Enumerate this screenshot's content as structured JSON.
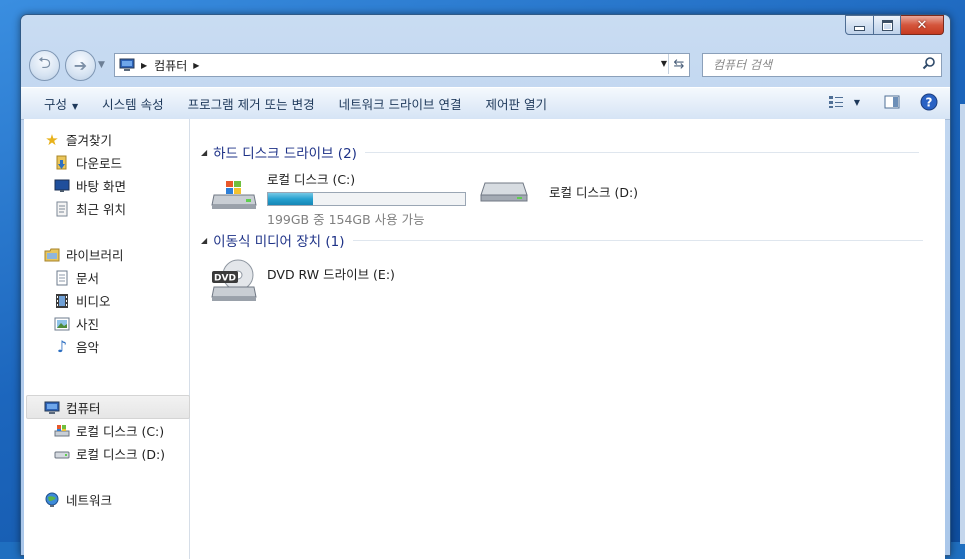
{
  "window": {
    "controls": {
      "minimize": "minimize-icon",
      "maximize": "maximize-icon",
      "close": "✕"
    }
  },
  "address_bar": {
    "breadcrumb": [
      "컴퓨터"
    ]
  },
  "search": {
    "placeholder": "컴퓨터 검색"
  },
  "toolbar": {
    "items": [
      "구성",
      "시스템 속성",
      "프로그램 제거 또는 변경",
      "네트워크 드라이브 연결",
      "제어판 열기"
    ],
    "right_icons": [
      "view-options-icon",
      "preview-pane-icon",
      "help-icon"
    ]
  },
  "nav_pane": {
    "favorites": {
      "label": "즐겨찾기",
      "items": [
        "다운로드",
        "바탕 화면",
        "최근 위치"
      ]
    },
    "libraries": {
      "label": "라이브러리",
      "items": [
        "문서",
        "비디오",
        "사진",
        "음악"
      ]
    },
    "computer": {
      "label": "컴퓨터",
      "items": [
        "로컬 디스크 (C:)",
        "로컬 디스크 (D:)"
      ]
    },
    "network": {
      "label": "네트워크"
    }
  },
  "main": {
    "hard_disks": {
      "header": "하드 디스크 드라이브 (2)",
      "drives": [
        {
          "name": "로컬 디스크 (C:)",
          "free_text": "199GB 중 154GB 사용 가능",
          "used_fraction": 0.226
        },
        {
          "name": "로컬 디스크 (D:)"
        }
      ]
    },
    "removable": {
      "header": "이동식 미디어 장치 (1)",
      "drives": [
        {
          "name": "DVD RW 드라이브 (E:)",
          "icon_text": "DVD"
        }
      ]
    }
  },
  "colors": {
    "accent": "#1e3287",
    "bar_fill": "#26a0cf",
    "toolbar_text": "#1e395b"
  }
}
